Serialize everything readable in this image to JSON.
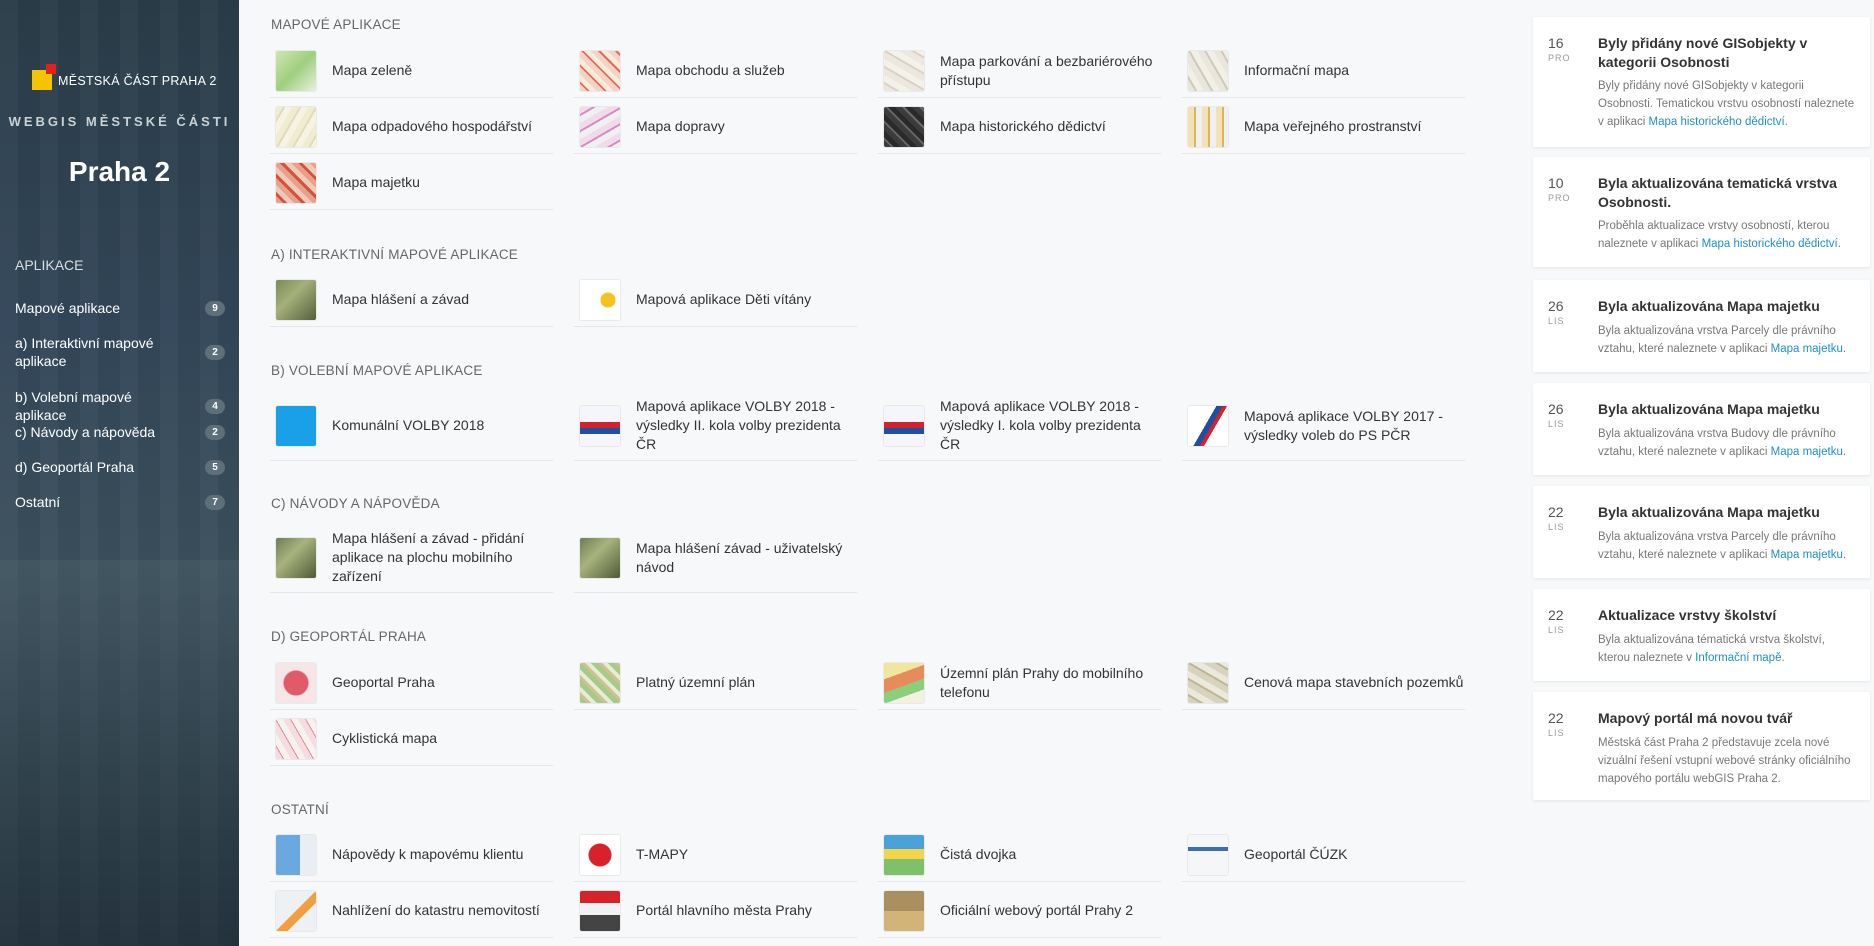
{
  "sidebar": {
    "logo_text": "MĚSTSKÁ ČÁST PRAHA 2",
    "subtitle": "WEBGIS MĚSTSKÉ ČÁSTI",
    "title": "Praha 2",
    "nav_heading": "APLIKACE",
    "items": [
      {
        "label": "Mapové aplikace",
        "count": "9"
      },
      {
        "label": "a) Interaktivní mapové aplikace",
        "count": "2"
      },
      {
        "label": "b) Volební mapové aplikace",
        "count": "4"
      },
      {
        "label": "c) Návody a nápověda",
        "count": "2"
      },
      {
        "label": "d) Geoportál Praha",
        "count": "5"
      },
      {
        "label": "Ostatní",
        "count": "7"
      }
    ]
  },
  "sections": {
    "mapove": {
      "heading": "MAPOVÉ APLIKACE",
      "cards": [
        "Mapa zeleně",
        "Mapa obchodu a služeb",
        "Mapa parkování a bezbariérového přístupu",
        "Informační mapa",
        "Mapa odpadového hospodářství",
        "Mapa dopravy",
        "Mapa historického dědictví",
        "Mapa veřejného prostranství",
        "Mapa majetku"
      ]
    },
    "interaktivni": {
      "heading": "A) INTERAKTIVNÍ MAPOVÉ APLIKACE",
      "cards": [
        "Mapa hlášení a závad",
        "Mapová aplikace Děti vítány"
      ]
    },
    "volebni": {
      "heading": "B) VOLEBNÍ MAPOVÉ APLIKACE",
      "cards": [
        "Komunální VOLBY 2018",
        "Mapová aplikace VOLBY 2018 - výsledky II. kola volby prezidenta ČR",
        "Mapová aplikace VOLBY 2018 - výsledky I. kola volby prezidenta ČR",
        "Mapová aplikace VOLBY 2017 - výsledky voleb do PS PČR"
      ]
    },
    "navody": {
      "heading": "C) NÁVODY A NÁPOVĚDA",
      "cards": [
        "Mapa hlášení a závad - přidání aplikace na plochu mobilního zařízení",
        "Mapa hlášení závad - uživatelský návod"
      ]
    },
    "geoportal": {
      "heading": "D) GEOPORTÁL PRAHA",
      "cards": [
        "Geoportal Praha",
        "Platný územní plán",
        "Územní plán Prahy do mobilního telefonu",
        "Cenová mapa stavebních pozemků",
        "Cyklistická mapa"
      ]
    },
    "ostatni": {
      "heading": "OSTATNÍ",
      "cards": [
        "Nápovědy k mapovému klientu",
        "T-MAPY",
        "Čistá dvojka",
        "Geoportál ČÚZK",
        "Nahlížení do katastru nemovitostí",
        "Portál hlavního města Prahy",
        "Oficiální webový portál Prahy 2"
      ]
    }
  },
  "news": [
    {
      "day": "16",
      "mon": "PRO",
      "title": "Byly přidány nové GISobjekty v kategorii Osobnosti",
      "body": "Byly přidány nové GISobjekty v kategorii Osobnosti. Tematickou vrstvu osobností naleznete v aplikaci ",
      "link": "Mapa historického dědictví",
      "tail": "."
    },
    {
      "day": "10",
      "mon": "PRO",
      "title": "Byla aktualizována tematická vrstva Osobnosti.",
      "body": "Proběhla aktualizace vrstvy osobností, kterou naleznete v aplikaci ",
      "link": "Mapa historického dědictví",
      "tail": "."
    },
    {
      "day": "26",
      "mon": "LIS",
      "title": "Byla aktualizována Mapa majetku",
      "body": "Byla aktualizována vrstva Parcely dle právního vztahu, které naleznete v aplikaci ",
      "link": "Mapa majetku",
      "tail": "."
    },
    {
      "day": "26",
      "mon": "LIS",
      "title": "Byla aktualizována Mapa majetku",
      "body": "Byla aktualizována vrstva Budovy dle právního vztahu, které naleznete v aplikaci ",
      "link": "Mapa majetku",
      "tail": "."
    },
    {
      "day": "22",
      "mon": "LIS",
      "title": "Byla aktualizována Mapa majetku",
      "body": "Byla aktualizována vrstva Parcely dle právního vztahu, které naleznete v aplikaci ",
      "link": "Mapa majetku",
      "tail": "."
    },
    {
      "day": "22",
      "mon": "LIS",
      "title": "Aktualizace vrstvy školství",
      "body": "Byla aktualizována tématická vrstva školství, kterou naleznete v ",
      "link": "Informační mapě",
      "tail": "."
    },
    {
      "day": "22",
      "mon": "LIS",
      "title": "Mapový portál má novou tvář",
      "body": "Městská část Praha 2 představuje zcela nové vizuální řešení vstupní webové stránky oficiálního mapového portálu webGIS Praha 2.",
      "link": "",
      "tail": ""
    }
  ],
  "colors": {
    "sidebar_bg": "#33475a",
    "link": "#1e90c8",
    "logo_yellow": "#f5c400",
    "logo_red": "#e32119"
  }
}
